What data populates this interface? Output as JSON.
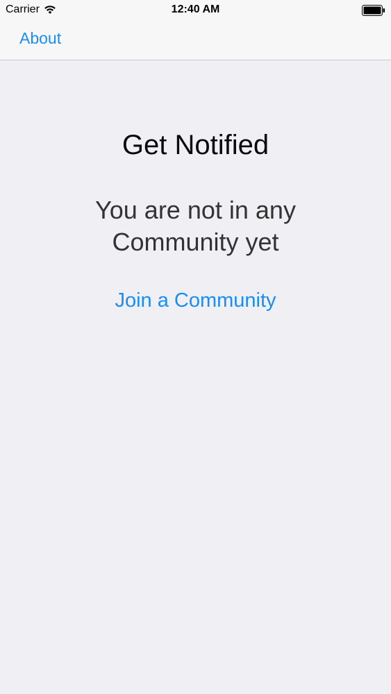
{
  "status_bar": {
    "carrier": "Carrier",
    "time": "12:40 AM",
    "icons": [
      "wifi-icon",
      "battery-icon"
    ]
  },
  "nav": {
    "about_label": "About"
  },
  "main": {
    "title": "Get Notified",
    "message_line1": "You are not in any",
    "message_line2": "Community yet",
    "join_label": "Join a Community"
  },
  "colors": {
    "accent": "#1a8ef0",
    "background": "#efeff4",
    "navbar": "#f7f7f8"
  }
}
